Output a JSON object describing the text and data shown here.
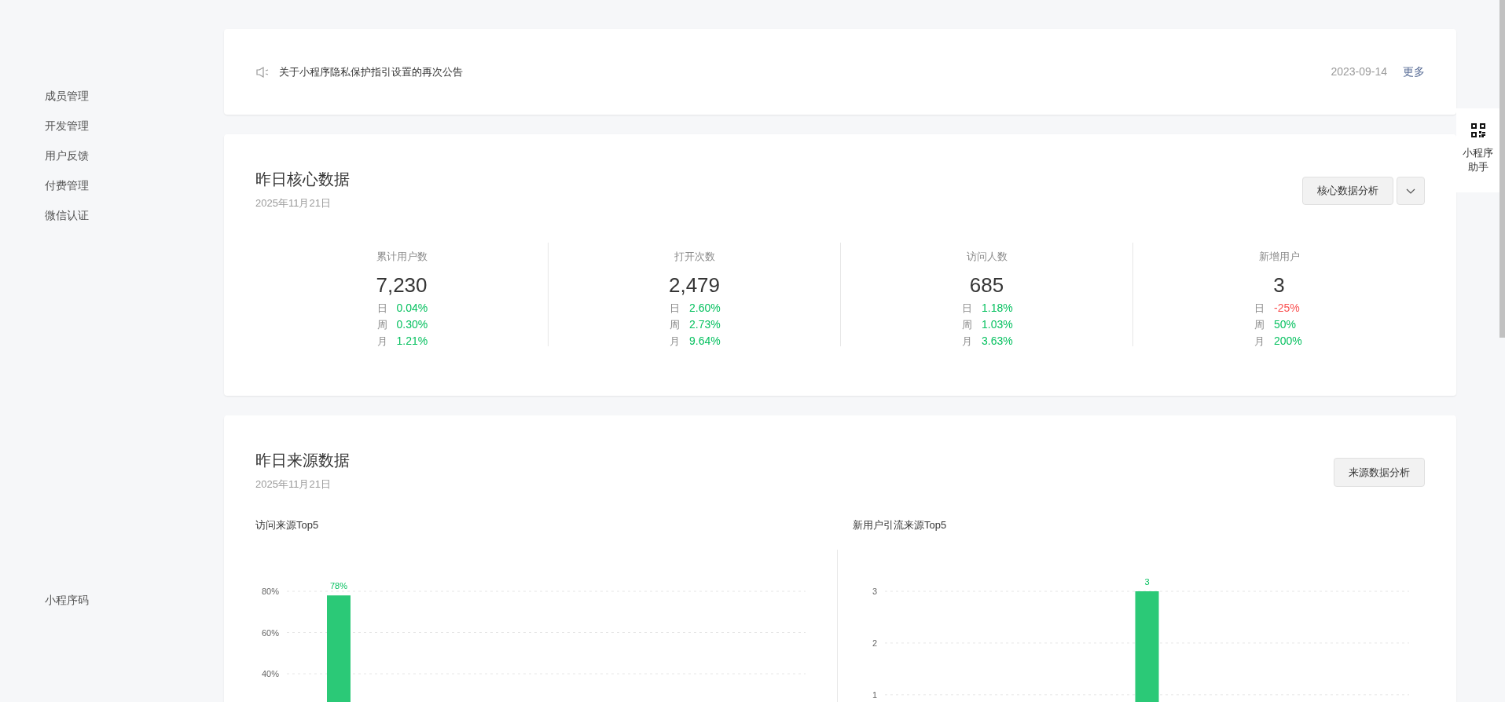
{
  "sidebar": {
    "items": [
      {
        "label": "成员管理"
      },
      {
        "label": "开发管理"
      },
      {
        "label": "用户反馈"
      },
      {
        "label": "付费管理"
      },
      {
        "label": "微信认证"
      }
    ],
    "bottom_item": {
      "label": "小程序码"
    }
  },
  "notice": {
    "text": "关于小程序隐私保护指引设置的再次公告",
    "date": "2023-09-14",
    "more": "更多"
  },
  "helper": {
    "label": "小程序助手"
  },
  "core": {
    "title": "昨日核心数据",
    "date": "2025年11月21日",
    "button": "核心数据分析",
    "metrics": [
      {
        "label": "累计用户数",
        "value": "7,230",
        "changes": [
          {
            "period": "日",
            "value": "0.04%",
            "color": "#07c160"
          },
          {
            "period": "周",
            "value": "0.30%",
            "color": "#07c160"
          },
          {
            "period": "月",
            "value": "1.21%",
            "color": "#07c160"
          }
        ]
      },
      {
        "label": "打开次数",
        "value": "2,479",
        "changes": [
          {
            "period": "日",
            "value": "2.60%",
            "color": "#07c160"
          },
          {
            "period": "周",
            "value": "2.73%",
            "color": "#07c160"
          },
          {
            "period": "月",
            "value": "9.64%",
            "color": "#07c160"
          }
        ]
      },
      {
        "label": "访问人数",
        "value": "685",
        "changes": [
          {
            "period": "日",
            "value": "1.18%",
            "color": "#07c160"
          },
          {
            "period": "周",
            "value": "1.03%",
            "color": "#07c160"
          },
          {
            "period": "月",
            "value": "3.63%",
            "color": "#07c160"
          }
        ]
      },
      {
        "label": "新增用户",
        "value": "3",
        "changes": [
          {
            "period": "日",
            "value": "-25%",
            "color": "#fa5151"
          },
          {
            "period": "周",
            "value": "50%",
            "color": "#07c160"
          },
          {
            "period": "月",
            "value": "200%",
            "color": "#07c160"
          }
        ]
      }
    ]
  },
  "source": {
    "title": "昨日来源数据",
    "date": "2025年11月21日",
    "button": "来源数据分析",
    "charts": [
      {
        "title": "访问来源Top5",
        "chart_data": {
          "type": "bar",
          "values": [
            78,
            null,
            null,
            null,
            null
          ],
          "ylim": [
            24,
            80
          ],
          "yticks": [
            {
              "value": 40,
              "label": "40%"
            },
            {
              "value": 60,
              "label": "60%"
            },
            {
              "value": 80,
              "label": "80%"
            }
          ],
          "data_labels": true,
          "value_labels": [
            "78%",
            null,
            null,
            null,
            null
          ]
        }
      },
      {
        "title": "新用户引流来源Top5",
        "chart_data": {
          "type": "bar",
          "values": [
            null,
            null,
            3,
            null,
            null
          ],
          "ylim": [
            0.77,
            3
          ],
          "yticks": [
            1,
            2,
            3
          ],
          "data_labels": true,
          "value_labels": [
            null,
            null,
            "3",
            null,
            null
          ]
        }
      }
    ]
  }
}
